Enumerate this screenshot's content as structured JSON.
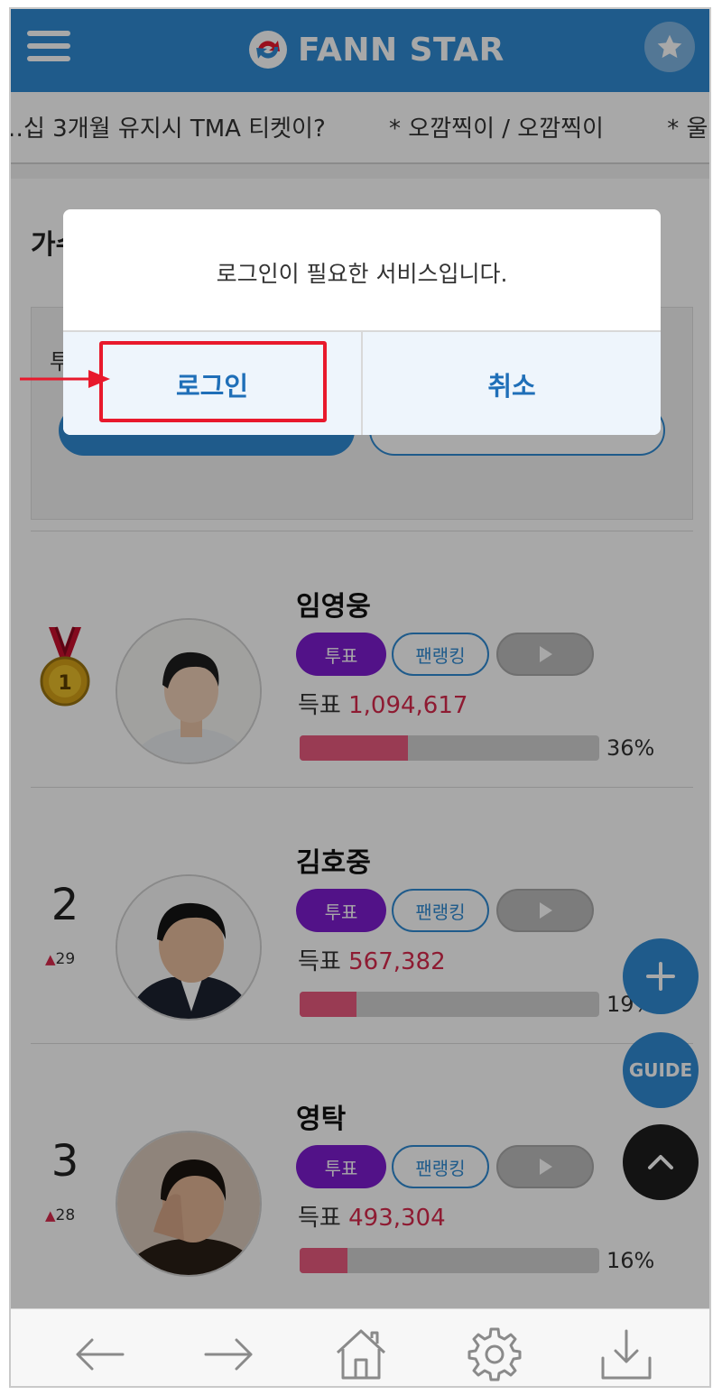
{
  "app": {
    "logo_text": "FANN STAR",
    "colors": {
      "brand": "#2f8bd3",
      "vote": "#7d1ccf",
      "score": "#d8294d",
      "bar": "#e85a7e"
    }
  },
  "ticker": {
    "items": [
      "…십 3개월 유지시 TMA 티켓이?",
      "* 오깜찍이 / 오깜찍이",
      "* 울 히"
    ]
  },
  "section": {
    "title": "가수"
  },
  "vote_box": {
    "label": "투"
  },
  "ranking": [
    {
      "rank": "",
      "medal": "gold-medal-1",
      "change": "",
      "name": "임영웅",
      "vote_label": "투표",
      "fanrank_label": "팬랭킹",
      "score_label": "득표",
      "score": "1,094,617",
      "percent": "36%",
      "fill": 0.36
    },
    {
      "rank": "2",
      "change": "29",
      "name": "김호중",
      "vote_label": "투표",
      "fanrank_label": "팬랭킹",
      "score_label": "득표",
      "score": "567,382",
      "percent": "19%",
      "fill": 0.19
    },
    {
      "rank": "3",
      "change": "28",
      "name": "영탁",
      "vote_label": "투표",
      "fanrank_label": "팬랭킹",
      "score_label": "득표",
      "score": "493,304",
      "percent": "16%",
      "fill": 0.16
    }
  ],
  "fab": {
    "guide_label": "GUIDE"
  },
  "dialog": {
    "message": "로그인이 필요한 서비스입니다.",
    "login_label": "로그인",
    "cancel_label": "취소"
  }
}
